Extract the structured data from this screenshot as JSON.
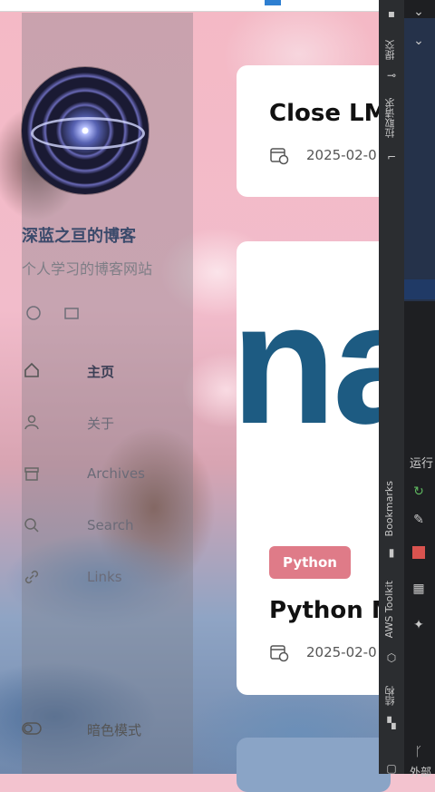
{
  "sidebar": {
    "site_title": "深蓝之亘的博客",
    "site_subtitle": "个人学习的博客网站",
    "nav": [
      {
        "label": "主页",
        "icon": "home-icon",
        "active": true
      },
      {
        "label": "关于",
        "icon": "user-icon",
        "active": false
      },
      {
        "label": "Archives",
        "icon": "archive-icon",
        "active": false
      },
      {
        "label": "Search",
        "icon": "search-icon",
        "active": false
      },
      {
        "label": "Links",
        "icon": "link-icon",
        "active": false
      }
    ],
    "dark_mode_label": "暗色模式"
  },
  "posts": [
    {
      "title": "Close LM",
      "date": "2025-02-0"
    },
    {
      "tag": "Python",
      "title": "Python M",
      "date": "2025-02-0",
      "hero_text": "na"
    }
  ],
  "ide": {
    "commit": "提交",
    "pull_requests": "拉取请求",
    "bookmarks": "Bookmarks",
    "aws_toolkit": "AWS Toolkit",
    "structure": "结构",
    "run_label": "运行",
    "external": "外部"
  },
  "colors": {
    "accent_tag": "#df7b88",
    "title_blue": "#3b4a6b",
    "hero_blue": "#1d5b82"
  }
}
